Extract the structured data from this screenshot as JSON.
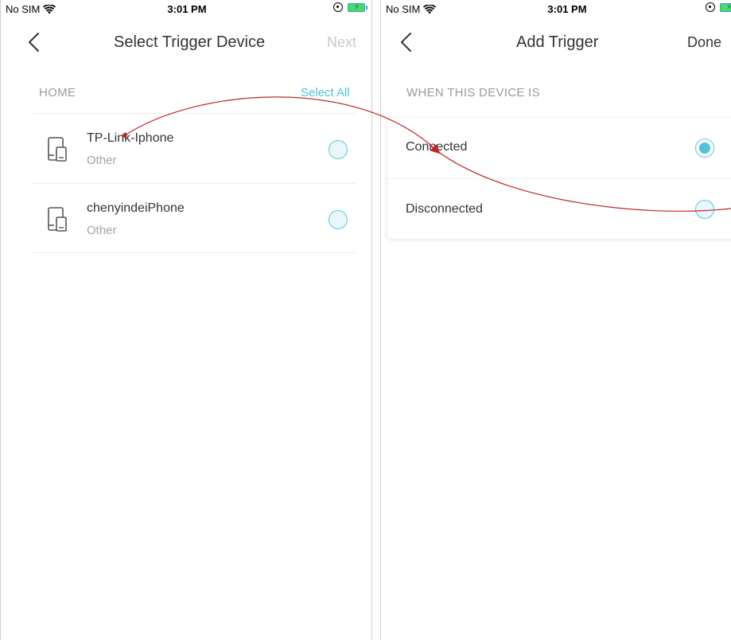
{
  "colors": {
    "accent": "#4fc3d8",
    "annotation_arrow": "#c0262d",
    "muted_text": "#9a9a9a"
  },
  "left_screen": {
    "status_bar": {
      "carrier": "No SIM",
      "time": "3:01 PM"
    },
    "nav": {
      "back_icon": "chevron-left-icon",
      "title": "Select Trigger Device",
      "next_label": "Next"
    },
    "section": {
      "title": "HOME",
      "select_all_label": "Select All"
    },
    "devices": [
      {
        "name": "TP-Link-Iphone",
        "type": "Other",
        "icon": "phone-tablet-icon",
        "selected": false
      },
      {
        "name": "chenyindeiPhone",
        "type": "Other",
        "icon": "phone-tablet-icon",
        "selected": false
      }
    ]
  },
  "right_screen": {
    "status_bar": {
      "carrier": "No SIM",
      "time": "3:01 PM"
    },
    "nav": {
      "back_icon": "chevron-left-icon",
      "title": "Add Trigger",
      "done_label": "Done"
    },
    "section": {
      "title": "WHEN THIS DEVICE IS"
    },
    "options": [
      {
        "label": "Connected",
        "selected": true
      },
      {
        "label": "Disconnected",
        "selected": false
      }
    ]
  }
}
